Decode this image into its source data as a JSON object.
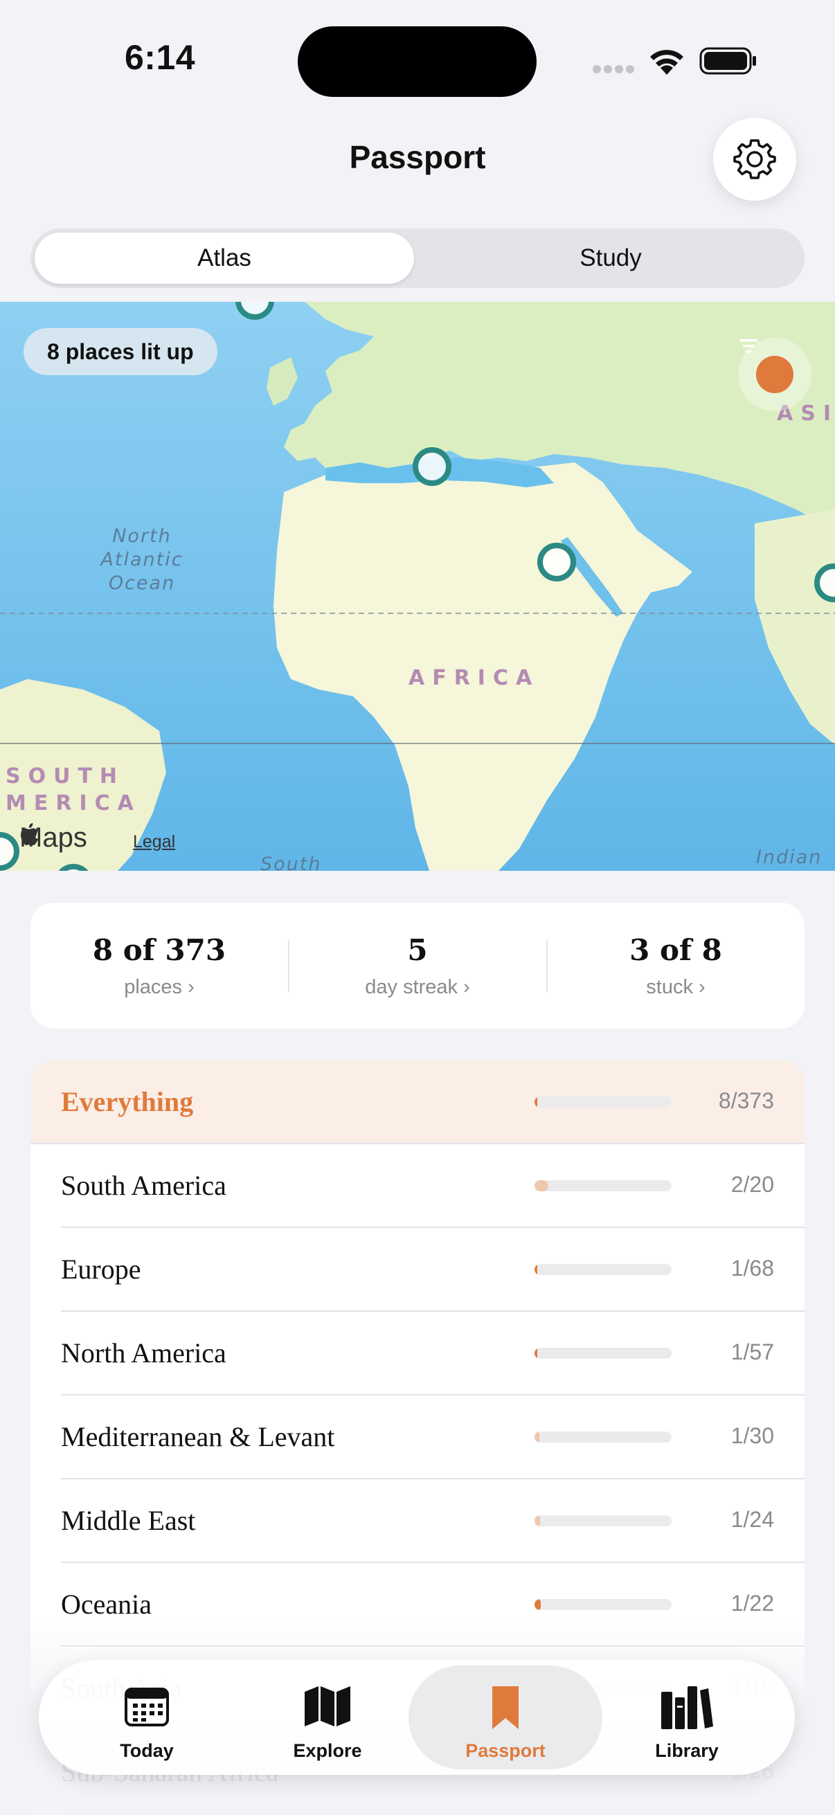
{
  "status_bar": {
    "time": "6:14"
  },
  "header": {
    "title": "Passport",
    "settings_icon": "gear-icon"
  },
  "segmented": {
    "options": [
      "Atlas",
      "Study"
    ],
    "selected": "Atlas"
  },
  "map": {
    "places_pill": "8 places lit up",
    "labels": {
      "ocean_north_atlantic": "North\nAtlantic\nOcean",
      "africa": "AFRICA",
      "asia": "ASI",
      "south_america": "SOUTH\nMERICA",
      "south": "South",
      "indian": "Indian"
    },
    "attribution": {
      "maps": "Maps",
      "legal": "Legal"
    },
    "filter_icon": "filter-icon"
  },
  "stats": [
    {
      "value": "8 of 373",
      "label": "places ›"
    },
    {
      "value": "5",
      "label": "day streak ›"
    },
    {
      "value": "3 of 8",
      "label": "stuck ›"
    }
  ],
  "regions": [
    {
      "name": "Everything",
      "count": "8/373",
      "progress": 0.021,
      "highlight": true
    },
    {
      "name": "South America",
      "count": "2/20",
      "progress": 0.1
    },
    {
      "name": "Europe",
      "count": "1/68",
      "progress": 0.015
    },
    {
      "name": "North America",
      "count": "1/57",
      "progress": 0.018
    },
    {
      "name": "Mediterranean & Levant",
      "count": "1/30",
      "progress": 0.033
    },
    {
      "name": "Middle East",
      "count": "1/24",
      "progress": 0.042
    },
    {
      "name": "Oceania",
      "count": "1/22",
      "progress": 0.045
    },
    {
      "name": "South Asia",
      "count": "1/15",
      "progress": 0.067
    },
    {
      "name": "Sub-Saharan Africa",
      "count": "0/26",
      "progress": 0
    }
  ],
  "colors": {
    "accent": "#e07a3c",
    "pin": "#2b8a83",
    "bar_light": "#efc7ad"
  },
  "tabbar": {
    "tabs": [
      {
        "label": "Today",
        "icon": "calendar-icon"
      },
      {
        "label": "Explore",
        "icon": "map-icon"
      },
      {
        "label": "Passport",
        "icon": "bookmark-icon",
        "active": true
      },
      {
        "label": "Library",
        "icon": "books-icon"
      }
    ]
  }
}
